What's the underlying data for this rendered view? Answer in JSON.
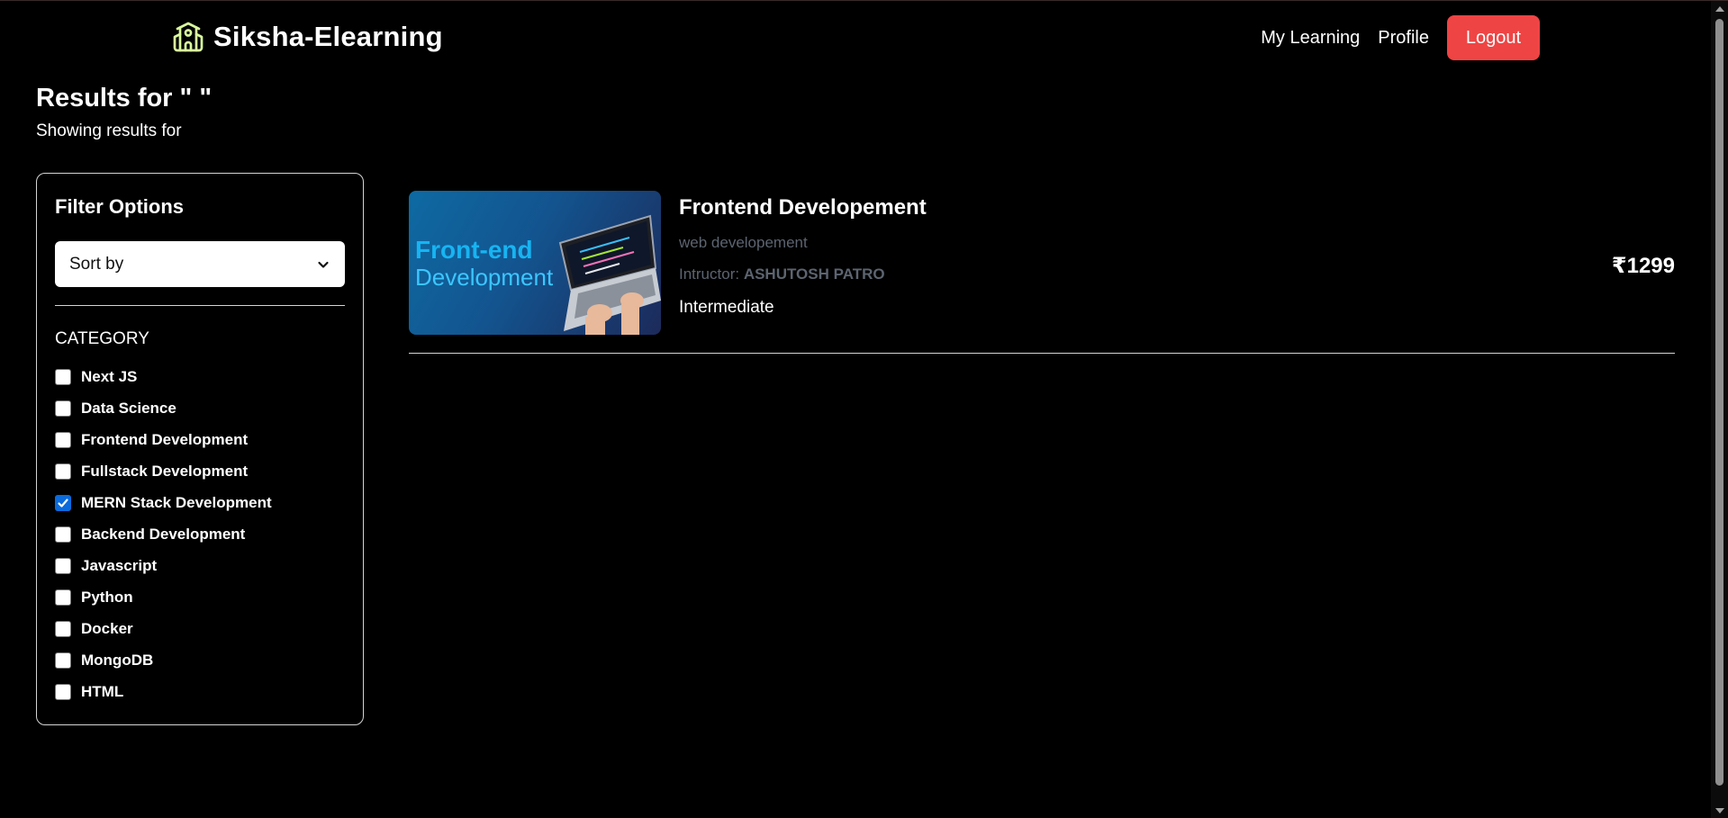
{
  "navbar": {
    "brand_name": "Siksha-Elearning",
    "brand_icon": "school-icon",
    "links": {
      "my_learning": "My Learning",
      "profile": "Profile"
    },
    "logout_label": "Logout",
    "logout_color": "#ef4444"
  },
  "results": {
    "title": "Results for \" \"",
    "subtitle": "Showing results for"
  },
  "filters": {
    "title": "Filter Options",
    "sort_selected": "Sort by",
    "category_heading": "CATEGORY",
    "categories": [
      {
        "label": "Next JS",
        "checked": false
      },
      {
        "label": "Data Science",
        "checked": false
      },
      {
        "label": "Frontend Development",
        "checked": false
      },
      {
        "label": "Fullstack Development",
        "checked": false
      },
      {
        "label": "MERN Stack Development",
        "checked": true
      },
      {
        "label": "Backend Development",
        "checked": false
      },
      {
        "label": "Javascript",
        "checked": false
      },
      {
        "label": "Python",
        "checked": false
      },
      {
        "label": "Docker",
        "checked": false
      },
      {
        "label": "MongoDB",
        "checked": false
      },
      {
        "label": "HTML",
        "checked": false
      }
    ]
  },
  "courses": [
    {
      "thumbnail_line1": "Front-end",
      "thumbnail_line2": "Development",
      "title": "Frontend Developement",
      "category": "web developement",
      "instructor_prefix": "Intructor: ",
      "instructor_name": "ASHUTOSH PATRO",
      "level": "Intermediate",
      "price": "₹1299"
    }
  ],
  "colors": {
    "background": "#000000",
    "checkbox_checked": "#0b6bdc",
    "muted_text": "#5c6470"
  }
}
